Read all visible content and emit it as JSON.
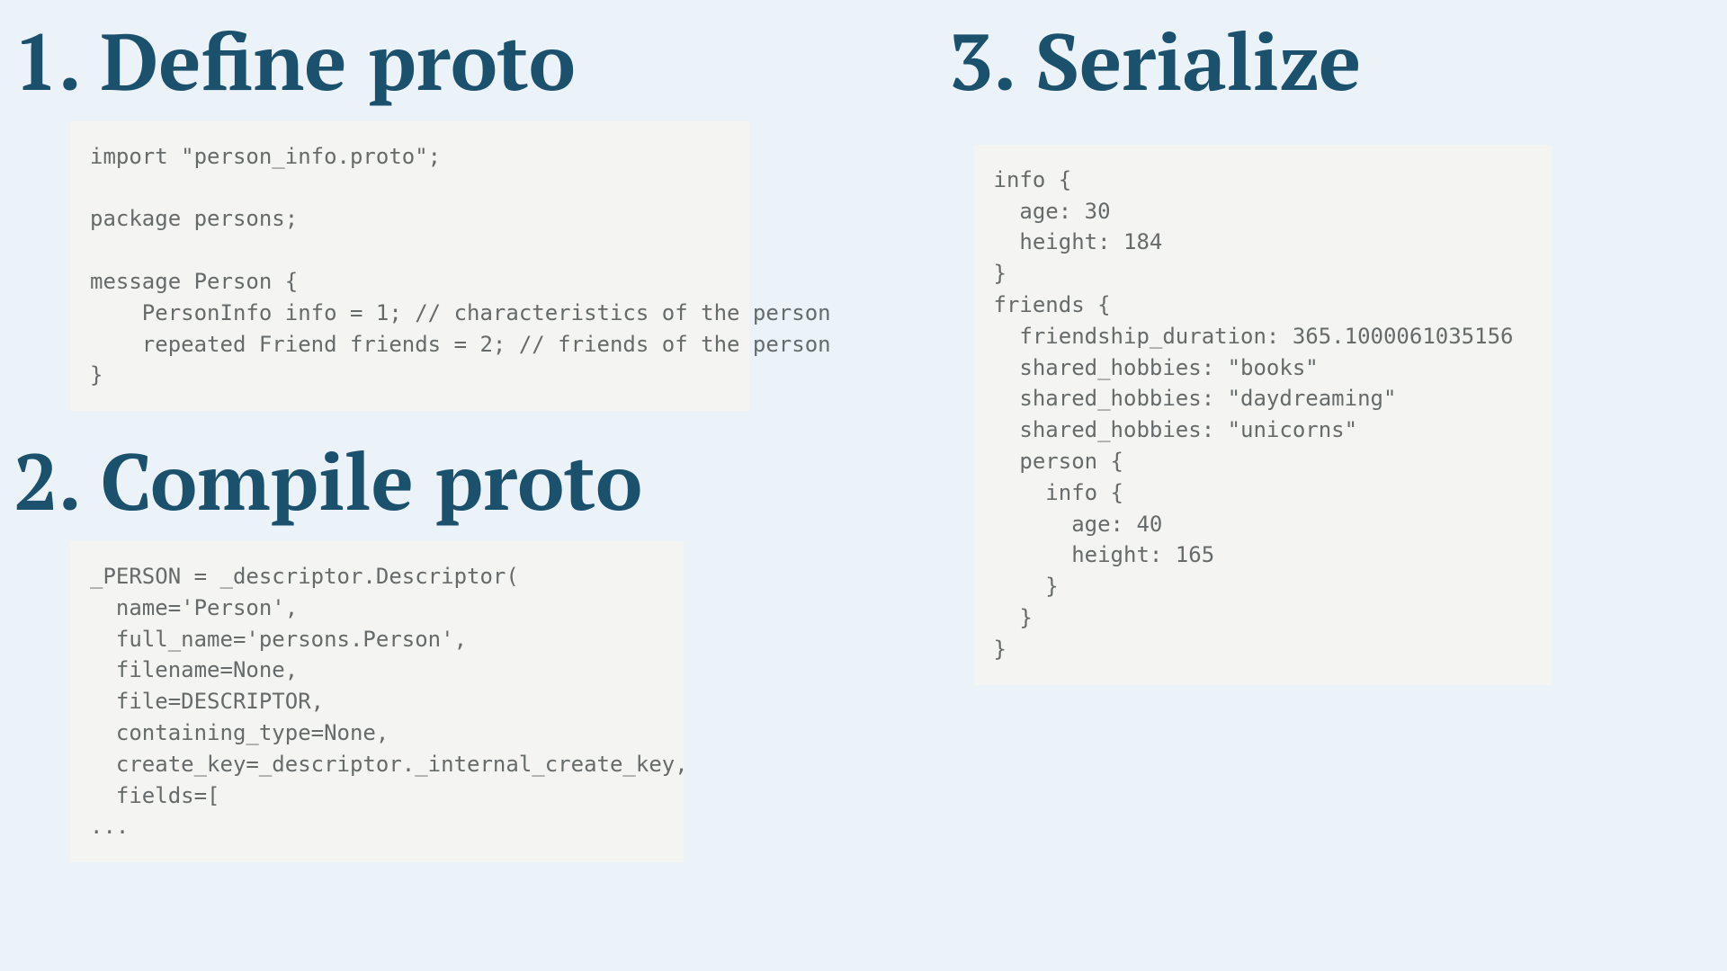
{
  "headings": {
    "define": "1. Define proto",
    "compile": "2. Compile proto",
    "serialize": "3. Serialize"
  },
  "code": {
    "define": "import \"person_info.proto\";\n\npackage persons;\n\nmessage Person {\n    PersonInfo info = 1; // characteristics of the person\n    repeated Friend friends = 2; // friends of the person\n}",
    "compile": "_PERSON = _descriptor.Descriptor(\n  name='Person',\n  full_name='persons.Person',\n  filename=None,\n  file=DESCRIPTOR,\n  containing_type=None,\n  create_key=_descriptor._internal_create_key,\n  fields=[\n...",
    "serialize": "info {\n  age: 30\n  height: 184\n}\nfriends {\n  friendship_duration: 365.1000061035156\n  shared_hobbies: \"books\"\n  shared_hobbies: \"daydreaming\"\n  shared_hobbies: \"unicorns\"\n  person {\n    info {\n      age: 40\n      height: 165\n    }\n  }\n}"
  }
}
